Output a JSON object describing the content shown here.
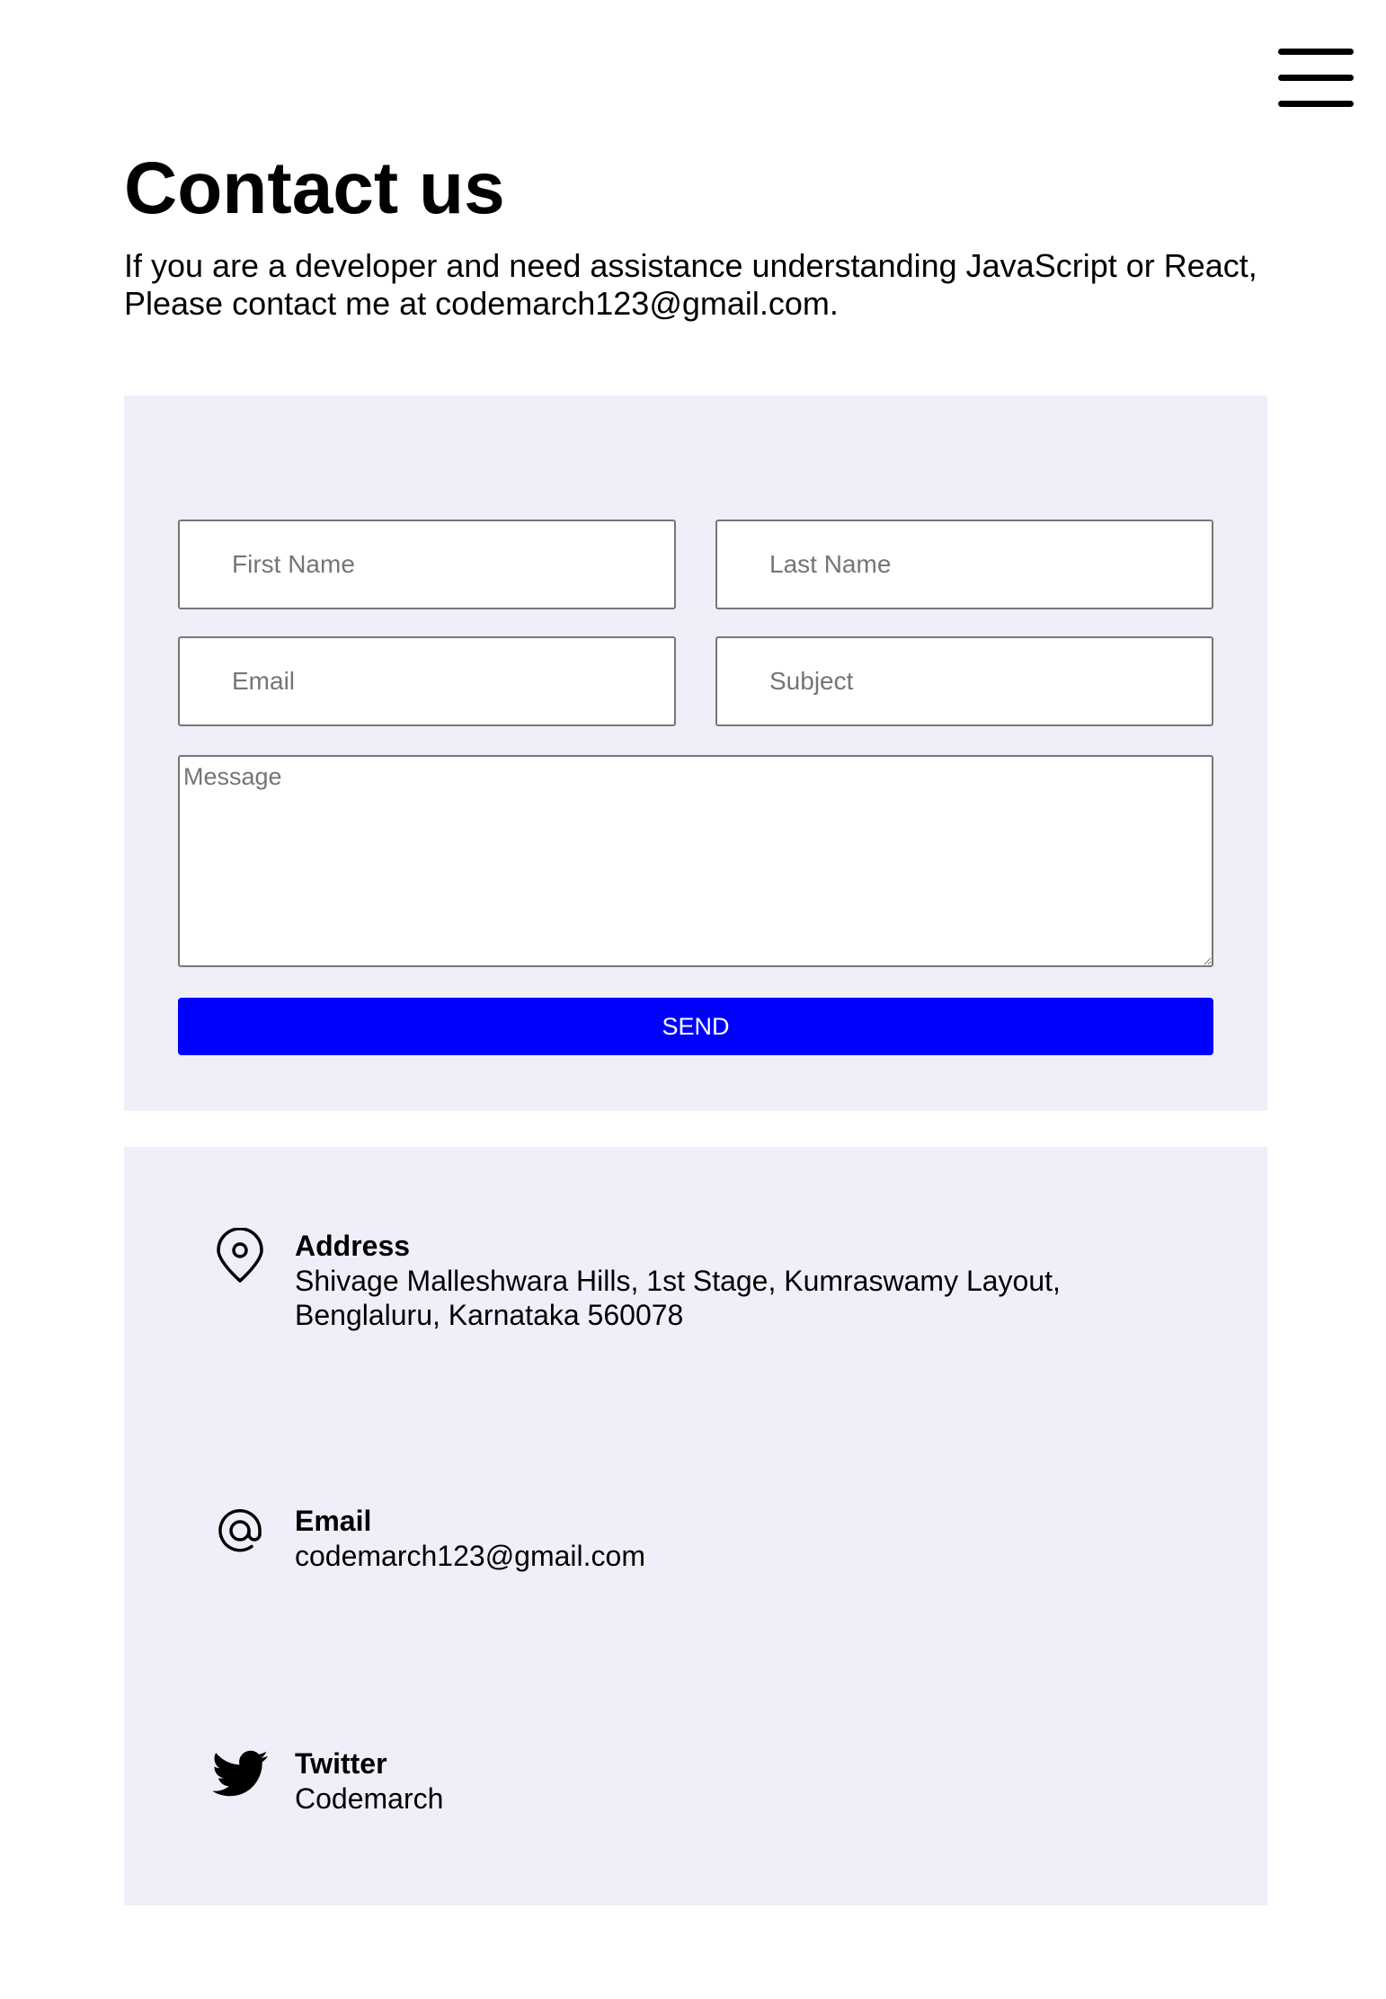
{
  "header": {
    "menu_icon": "hamburger-menu-icon"
  },
  "hero": {
    "title": "Contact us",
    "intro_line1": "If you are a developer and need assistance understanding JavaScript or React,",
    "intro_line2": "Please contact me at codemarch123@gmail.com."
  },
  "form": {
    "background_color": "#efeffa",
    "first_name": {
      "placeholder": "First Name",
      "value": ""
    },
    "last_name": {
      "placeholder": "Last Name",
      "value": ""
    },
    "email": {
      "placeholder": "Email",
      "value": ""
    },
    "subject": {
      "placeholder": "Subject",
      "value": ""
    },
    "message": {
      "placeholder": "Message",
      "value": ""
    },
    "send_label": "SEND",
    "send_color": "#0000ff"
  },
  "contact_info": {
    "background_color": "#efeffa",
    "items": [
      {
        "icon": "map-pin-icon",
        "label": "Address",
        "value": "Shivage Malleshwara Hills, 1st Stage, Kumraswamy Layout,\nBenglaluru, Karnataka 560078"
      },
      {
        "icon": "at-sign-icon",
        "label": "Email",
        "value": "codemarch123@gmail.com"
      },
      {
        "icon": "twitter-icon",
        "label": "Twitter",
        "value": "Codemarch"
      }
    ]
  }
}
